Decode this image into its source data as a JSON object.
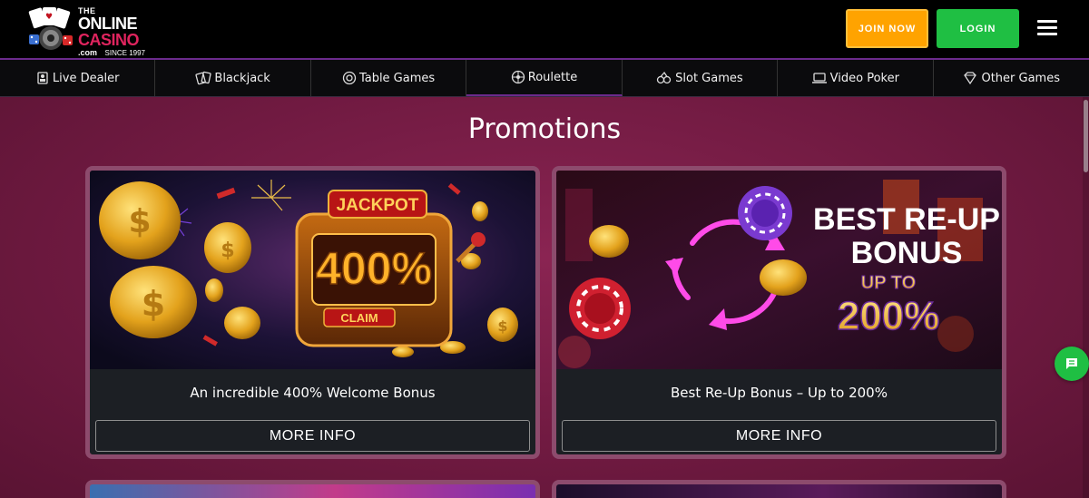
{
  "header": {
    "logo": {
      "the": "THE",
      "online": "ONLINE",
      "casino": "CASINO",
      "dotcom": ".com",
      "since": "SINCE 1997"
    },
    "join_label": "JOIN NOW",
    "login_label": "LOGIN"
  },
  "nav": {
    "items": [
      {
        "label": "Live Dealer",
        "icon": "live-dealer-icon"
      },
      {
        "label": "Blackjack",
        "icon": "blackjack-icon"
      },
      {
        "label": "Table Games",
        "icon": "table-games-icon"
      },
      {
        "label": "Roulette",
        "icon": "roulette-icon"
      },
      {
        "label": "Slot Games",
        "icon": "slot-games-icon"
      },
      {
        "label": "Video Poker",
        "icon": "video-poker-icon"
      },
      {
        "label": "Other Games",
        "icon": "diamond-icon"
      }
    ]
  },
  "main": {
    "title": "Promotions",
    "cards": [
      {
        "title": "An incredible 400% Welcome Bonus",
        "button": "MORE INFO",
        "image_text": {
          "jackpot": "JACKPOT",
          "percent": "400%",
          "claim": "CLAIM"
        }
      },
      {
        "title": "Best Re-Up Bonus – Up to 200%",
        "button": "MORE INFO",
        "image_text": {
          "line1": "BEST RE-UP",
          "line2": "BONUS",
          "upto": "UP TO",
          "percent": "200%"
        }
      }
    ]
  },
  "colors": {
    "join": "#ffa300",
    "login": "#1fbf43",
    "background": "#701a41",
    "card_border": "#8d4b6d",
    "brand_pink": "#e0245e"
  }
}
